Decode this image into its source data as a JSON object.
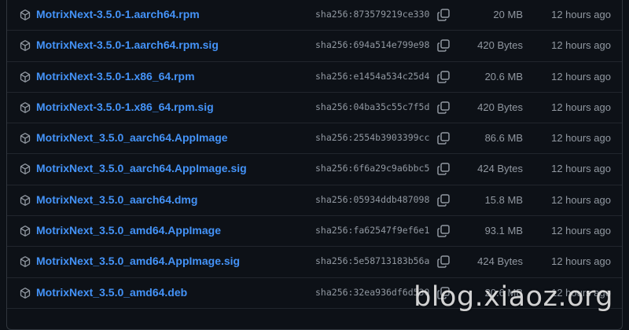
{
  "assets": [
    {
      "name": "MotrixNext-3.5.0-1.aarch64.rpm",
      "sha": "sha256:873579219ce330",
      "size": "20 MB",
      "time": "12 hours ago"
    },
    {
      "name": "MotrixNext-3.5.0-1.aarch64.rpm.sig",
      "sha": "sha256:694a514e799e98",
      "size": "420 Bytes",
      "time": "12 hours ago"
    },
    {
      "name": "MotrixNext-3.5.0-1.x86_64.rpm",
      "sha": "sha256:e1454a534c25d4",
      "size": "20.6 MB",
      "time": "12 hours ago"
    },
    {
      "name": "MotrixNext-3.5.0-1.x86_64.rpm.sig",
      "sha": "sha256:04ba35c55c7f5d",
      "size": "420 Bytes",
      "time": "12 hours ago"
    },
    {
      "name": "MotrixNext_3.5.0_aarch64.AppImage",
      "sha": "sha256:2554b3903399cc",
      "size": "86.6 MB",
      "time": "12 hours ago"
    },
    {
      "name": "MotrixNext_3.5.0_aarch64.AppImage.sig",
      "sha": "sha256:6f6a29c9a6bbc5",
      "size": "424 Bytes",
      "time": "12 hours ago"
    },
    {
      "name": "MotrixNext_3.5.0_aarch64.dmg",
      "sha": "sha256:05934ddb487098",
      "size": "15.8 MB",
      "time": "12 hours ago"
    },
    {
      "name": "MotrixNext_3.5.0_amd64.AppImage",
      "sha": "sha256:fa62547f9ef6e1",
      "size": "93.1 MB",
      "time": "12 hours ago"
    },
    {
      "name": "MotrixNext_3.5.0_amd64.AppImage.sig",
      "sha": "sha256:5e58713183b56a",
      "size": "424 Bytes",
      "time": "12 hours ago"
    },
    {
      "name": "MotrixNext_3.5.0_amd64.deb",
      "sha": "sha256:32ea936df6d530",
      "size": "20.6 MB",
      "time": "12 hours ago"
    }
  ],
  "icons": {
    "asset": "package-icon",
    "copy": "copy-icon"
  },
  "colors": {
    "background": "#0d1117",
    "link": "#4493f8",
    "muted": "#9198a1",
    "border": "#30363d"
  },
  "watermark": "blog.xiaoz.org"
}
